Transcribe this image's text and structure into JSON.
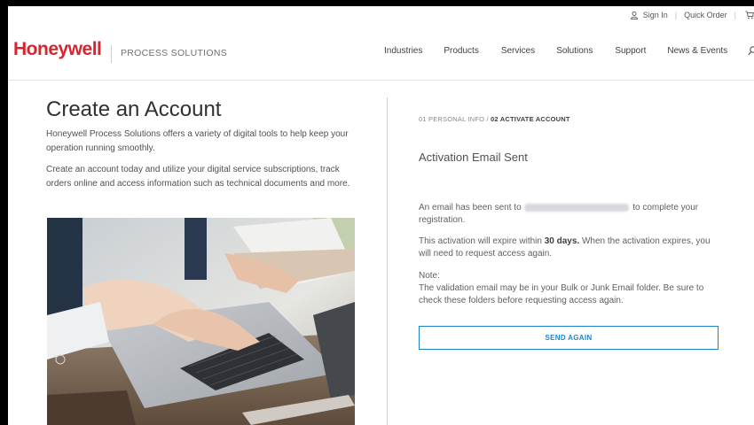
{
  "utility": {
    "sign_in": "Sign In",
    "quick_order": "Quick Order",
    "separator": "|",
    "user_icon": "user-icon",
    "cart_icon": "cart-icon"
  },
  "header": {
    "logo": "Honeywell",
    "tagline": "PROCESS SOLUTIONS",
    "nav": [
      "Industries",
      "Products",
      "Services",
      "Solutions",
      "Support",
      "News & Events"
    ],
    "search_icon": "search-icon",
    "brand_color": "#d8242f"
  },
  "left": {
    "title": "Create an Account",
    "intro": "Honeywell Process Solutions offers a variety of digital tools to help keep your operation running smoothly.",
    "intro2": "Create an account today and utilize your digital service subscriptions, track orders online and access information such as technical documents and more."
  },
  "right": {
    "step1": "01 PERSONAL INFO / ",
    "step2": "02 ACTIVATE ACCOUNT",
    "heading": "Activation Email Sent",
    "msg1_before": "An email has been sent to ",
    "msg1_after": " to complete your registration.",
    "msg2_before": "This activation will expire within ",
    "msg2_bold": "30 days.",
    "msg2_after": " When the activation expires, you will need to request access again.",
    "note_label": "Note:",
    "note_text": "The validation email may be in your Bulk or Junk Email folder. Be sure to check these folders before requesting access again.",
    "button": "SEND AGAIN",
    "accent_color": "#1e84c7"
  }
}
